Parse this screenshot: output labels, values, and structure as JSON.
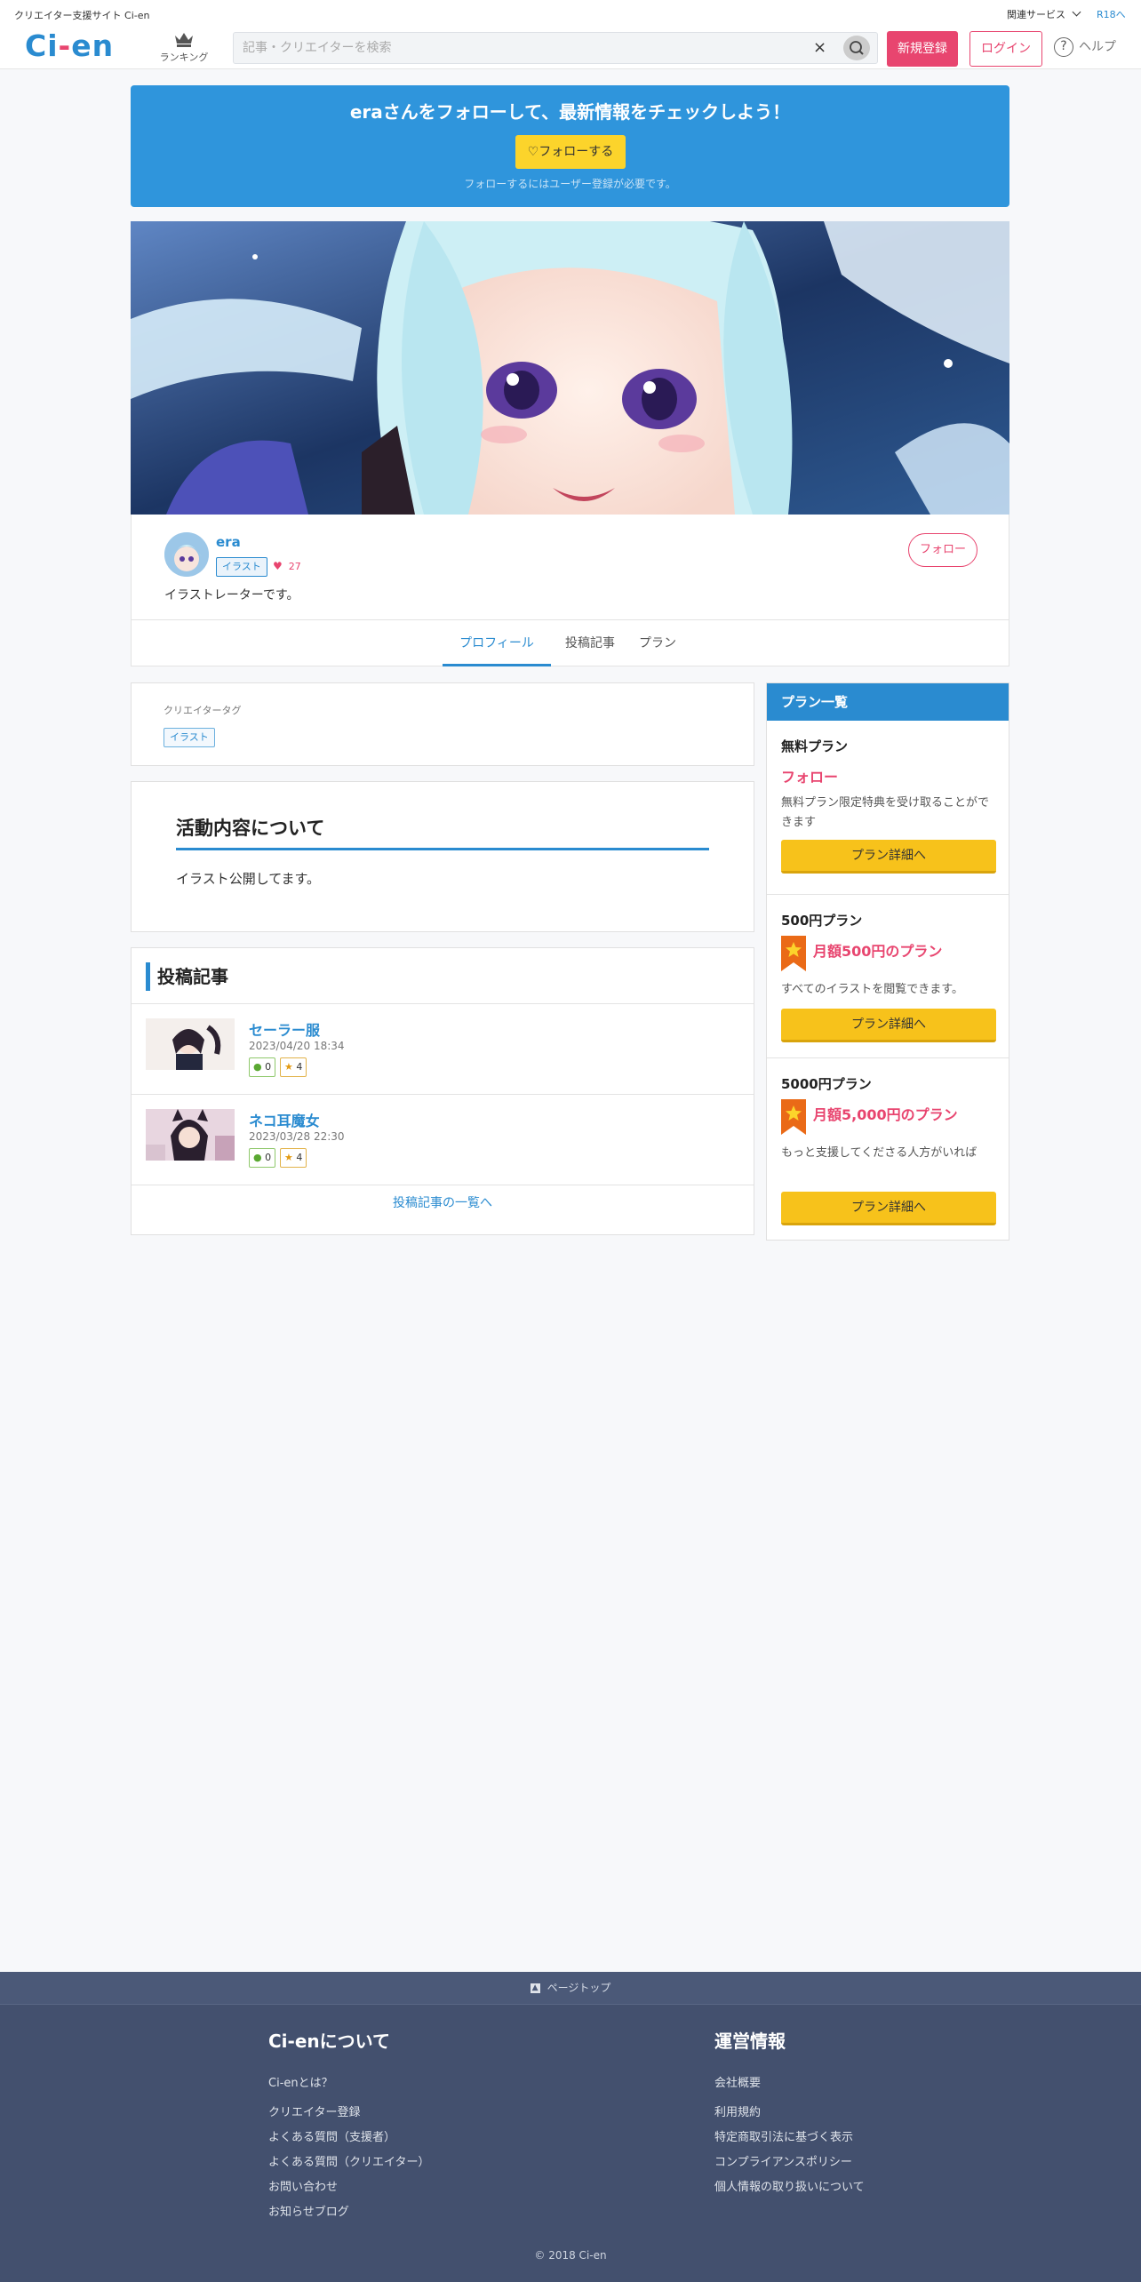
{
  "topbar": {
    "site_name": "クリエイター支援サイト Ci-en",
    "related_services": "関連サービス",
    "r18_link": "R18へ"
  },
  "header": {
    "logo_ci": "Ci",
    "logo_dash": "-",
    "logo_en": "en",
    "ranking_label": "ランキング",
    "search_placeholder": "記事・クリエイターを検索",
    "clear_symbol": "×",
    "register_label": "新規登録",
    "login_label": "ログイン",
    "help_label": "ヘルプ",
    "help_symbol": "?"
  },
  "banner": {
    "title": "eraさんをフォローして、最新情報をチェックしよう！",
    "follow_button": "♡フォローする",
    "note": "フォローするにはユーザー登録が必要です。"
  },
  "profile": {
    "name": "era",
    "tag": "イラスト",
    "favorites": "27",
    "description": "イラストレーターです。",
    "follow_button": "フォロー",
    "tabs": [
      "プロフィール",
      "投稿記事",
      "プラン"
    ]
  },
  "creator_tags": {
    "label": "クリエイタータグ",
    "tags": [
      "イラスト"
    ]
  },
  "activity": {
    "heading": "活動内容について",
    "body": "イラスト公開してます。"
  },
  "posts": {
    "heading": "投稿記事",
    "items": [
      {
        "title": "セーラー服",
        "date": "2023/04/20 18:34",
        "comments": "0",
        "stars": "4"
      },
      {
        "title": "ネコ耳魔女",
        "date": "2023/03/28 22:30",
        "comments": "0",
        "stars": "4"
      }
    ],
    "more_link": "投稿記事の一覧へ"
  },
  "plans": {
    "heading": "プラン一覧",
    "items": [
      {
        "name": "無料プラン",
        "title": "フォロー",
        "description": "無料プラン限定特典を受け取ることができます",
        "button": "プラン詳細へ"
      },
      {
        "name": "500円プラン",
        "title": "月額500円のプラン",
        "description": "すべてのイラストを閲覧できます。",
        "button": "プラン詳細へ"
      },
      {
        "name": "5000円プラン",
        "title": "月額5,000円のプラン",
        "description": "もっと支援してくださる人方がいれば",
        "button": "プラン詳細へ"
      }
    ]
  },
  "footer": {
    "page_top": "ページトップ",
    "about_heading": "Ci-enについて",
    "about_links": [
      "Ci-enとは？",
      "クリエイター登録",
      "よくある質問（支援者）",
      "よくある質問（クリエイター）",
      "お問い合わせ",
      "お知らせブログ"
    ],
    "ops_heading": "運営情報",
    "ops_links": [
      "会社概要",
      "利用規約",
      "特定商取引法に基づく表示",
      "コンプライアンスポリシー",
      "個人情報の取り扱いについて"
    ],
    "copyright": "© 2018 Ci-en"
  },
  "colors": {
    "brand_blue": "#2a8bd0",
    "brand_pink": "#e8456f",
    "button_yellow": "#f7c21b",
    "footer_bg": "#43506e"
  }
}
